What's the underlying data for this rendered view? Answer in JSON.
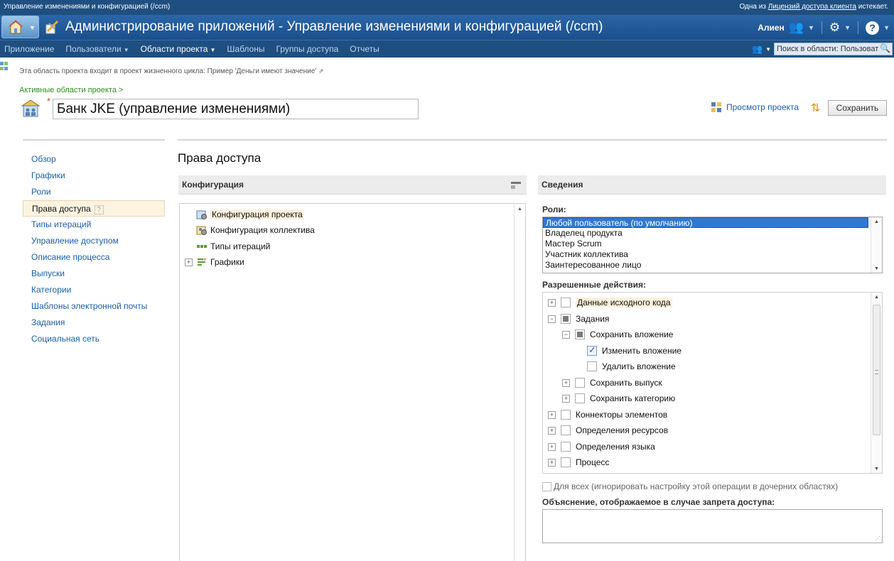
{
  "topbar": {
    "window_title": "Управление изменениями и конфигурацией (/ccm)",
    "license_prefix": "Одна из",
    "license_link": "Лицензий доступа клиента",
    "license_suffix": "истекает."
  },
  "header": {
    "title": "Администрирование приложений - Управление изменениями и конфигурацией (/ccm)",
    "user": "Алиен"
  },
  "nav": {
    "items": [
      {
        "label": "Приложение",
        "dropdown": false
      },
      {
        "label": "Пользователи",
        "dropdown": true
      },
      {
        "label": "Области проекта",
        "dropdown": true,
        "active": true
      },
      {
        "label": "Шаблоны",
        "dropdown": false
      },
      {
        "label": "Группы доступа",
        "dropdown": false
      },
      {
        "label": "Отчеты",
        "dropdown": false
      }
    ],
    "search_placeholder": "Поиск в области: Пользоват"
  },
  "project": {
    "lifecycle_text": "Эта область проекта входит в проект жизненного цикла: Пример 'Деньги имеют значение'",
    "breadcrumb": "Активные области проекта >",
    "name": "Банк JKE (управление изменениями)",
    "view_project": "Просмотр проекта",
    "save_label": "Сохранить"
  },
  "leftnav": {
    "items": [
      "Обзор",
      "Графики",
      "Роли",
      "Права доступа",
      "Типы итераций",
      "Управление доступом",
      "Описание процесса",
      "Выпуски",
      "Категории",
      "Шаблоны электронной почты",
      "Задания",
      "Социальная сеть"
    ],
    "active_index": 3,
    "help_mark": "?"
  },
  "main": {
    "title": "Права доступа",
    "config": {
      "header": "Конфигурация",
      "items": [
        "Конфигурация проекта",
        "Конфигурация коллектива",
        "Типы итераций",
        "Графики"
      ]
    },
    "details": {
      "header": "Сведения",
      "roles_label": "Роли:",
      "roles": [
        "Любой пользователь (по умолчанию)",
        "Владелец продукта",
        "Мастер Scrum",
        "Участник коллектива",
        "Заинтересованное лицо"
      ],
      "actions_label": "Разрешенные действия:",
      "actions": [
        "Данные исходного кода",
        "Задания",
        "Сохранить вложение",
        "Изменить вложение",
        "Удалить вложение",
        "Сохранить выпуск",
        "Сохранить категорию",
        "Коннекторы элементов",
        "Определения ресурсов",
        "Определения языка",
        "Процесс"
      ],
      "for_all_label": "Для всех (игнорировать настройку этой операции в дочерних областях)",
      "explanation_label": "Объяснение, отображаемое в случае запрета доступа:"
    }
  }
}
